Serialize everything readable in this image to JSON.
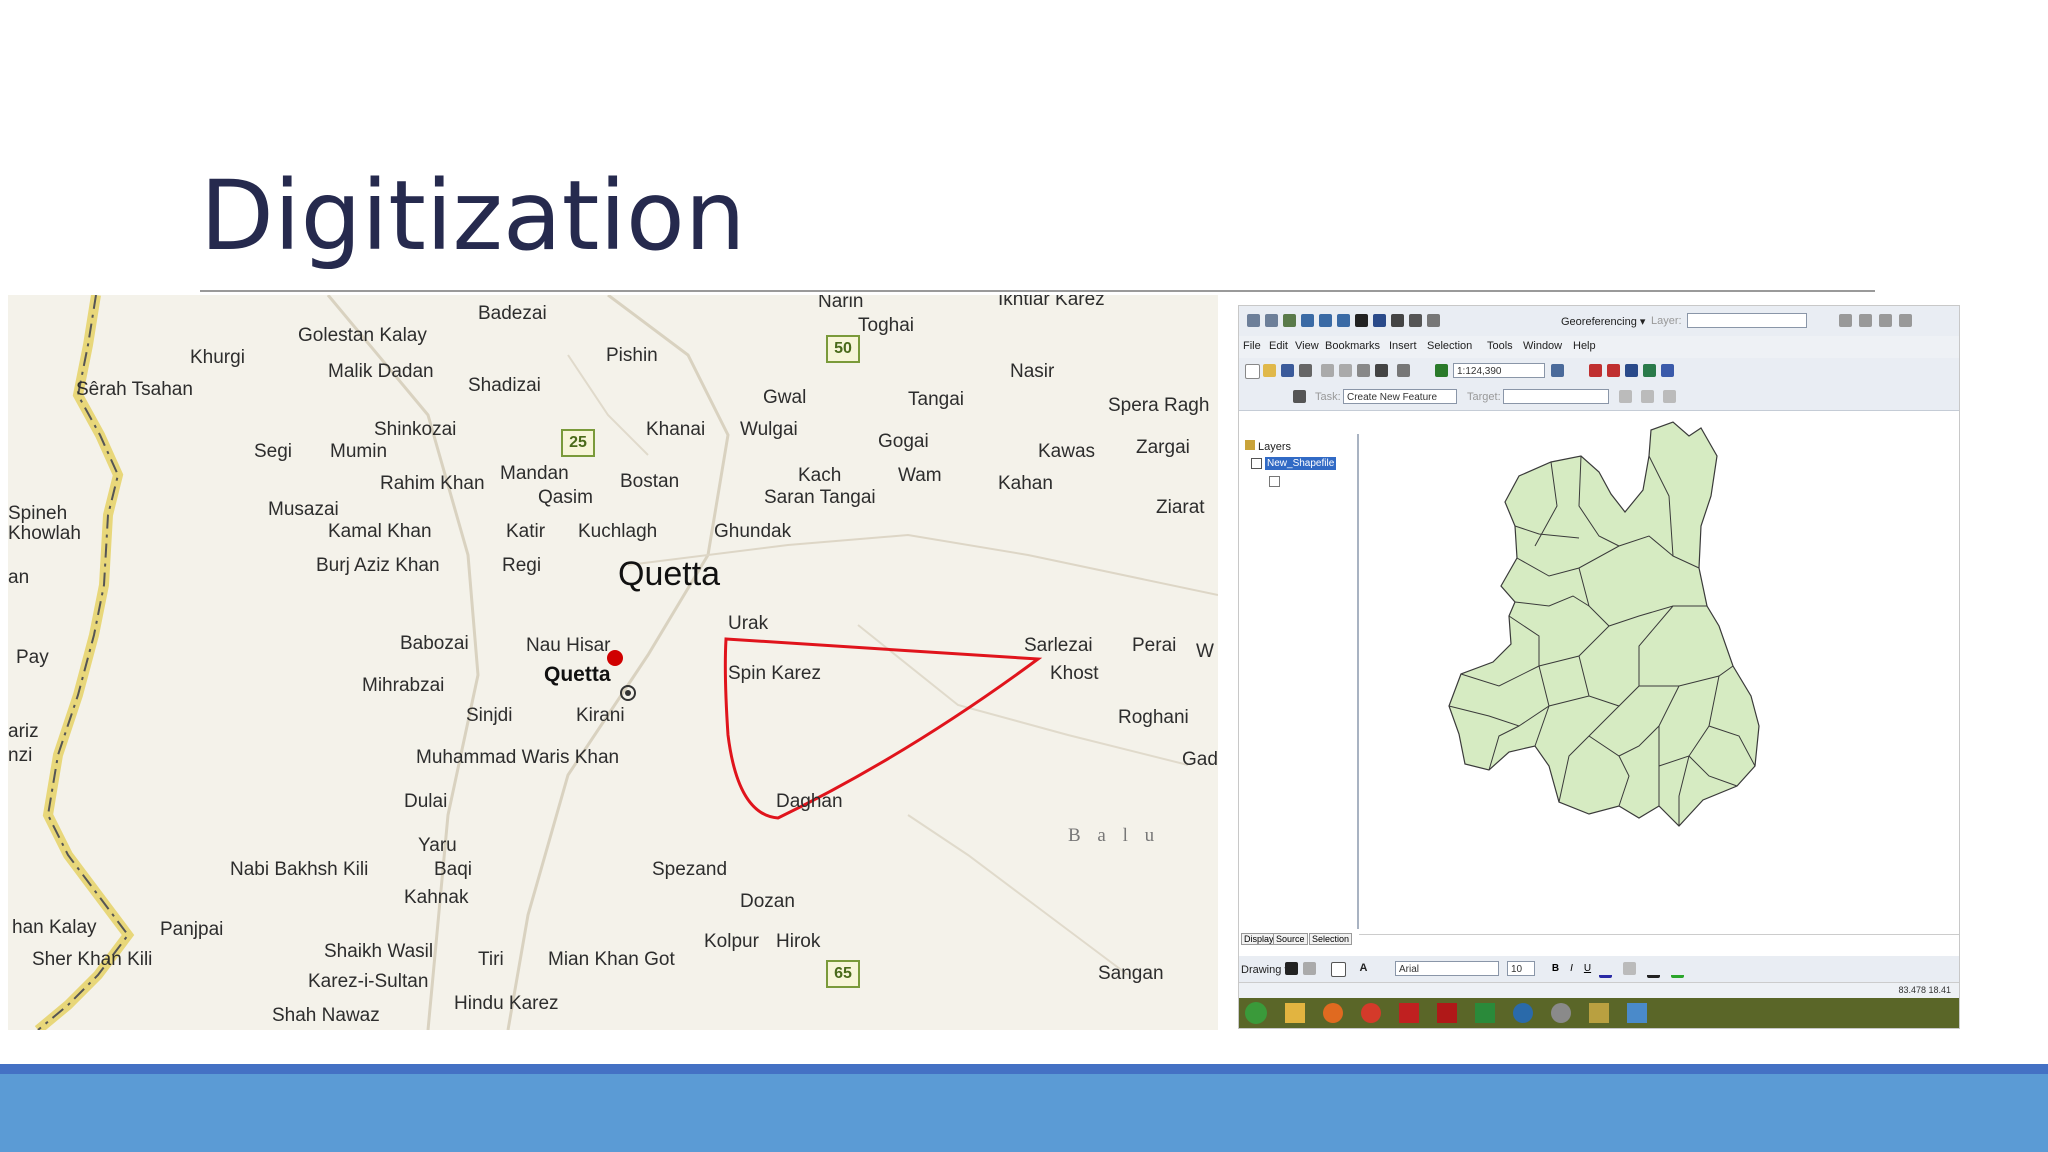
{
  "slide": {
    "title": "Digitization"
  },
  "map": {
    "cities": [
      "Quetta"
    ],
    "places": [
      "Badezai",
      "Narin",
      "Ikhtiar Karez",
      "Golestan Kalay",
      "Toghai",
      "Khurgi",
      "Pishin",
      "Malik Dadan",
      "Sêrah Tsahan",
      "Shadizai",
      "Gwal",
      "Tangai",
      "Nasir",
      "Spera Ragh",
      "Shinkozai",
      "Khanai",
      "Wulgai",
      "Gogai",
      "Kawas",
      "Zargai",
      "Segi",
      "Mumin",
      "Mandan",
      "Bostan",
      "Kach",
      "Wam",
      "Kahan",
      "Rahim Khan",
      "Qasim",
      "Saran Tangai",
      "Ziarat",
      "Spineh",
      "Khowlah",
      "Musazai",
      "Kamal Khan",
      "Katir",
      "Kuchlagh",
      "Ghundak",
      "an",
      "Burj Aziz Khan",
      "Regi",
      "Urak",
      "Babozai",
      "Nau Hisar",
      "Sarlezai",
      "Perai",
      "W",
      "Pay",
      "Spin Karez",
      "Khost",
      "Mihrabzai",
      "Sinjdi",
      "Kirani",
      "Roghani",
      "ariz",
      "nzi",
      "Muhammad Waris Khan",
      "Gad",
      "Dulai",
      "Daghan",
      "B a l u",
      "Yaru",
      "Baqi",
      "Nabi Bakhsh Kili",
      "Spezand",
      "Kahnak",
      "Dozan",
      "han Kalay",
      "Panjpai",
      "Kolpur",
      "Hirok",
      "Shaikh Wasil",
      "Tiri",
      "Mian Khan Got",
      "Sher Khan Kili",
      "Sangan",
      "Karez-i-Sultan",
      "Hindu Karez",
      "Shah Nawaz"
    ],
    "bold_places": [
      "Quetta"
    ],
    "road_shields": [
      "50",
      "25",
      "65"
    ],
    "colors": {
      "background": "#f4f2ea",
      "digitized_line": "#e0141c",
      "border": "#e8d77a",
      "road": "#d9d2c0"
    }
  },
  "gis": {
    "menu": [
      "File",
      "Edit",
      "View",
      "Bookmarks",
      "Insert",
      "Selection",
      "Tools",
      "Window",
      "Help"
    ],
    "georeferencing_label": "Georeferencing ▾",
    "layer_label": "Layer:",
    "scale_value": "1:124,390",
    "task_label": "Task:",
    "task_value": "Create New Feature",
    "target_label": "Target:",
    "toc_title": "Layers",
    "toc_layer": "New_Shapefile",
    "tabs": [
      "Display",
      "Source",
      "Selection"
    ],
    "drawing_label": "Drawing ▾",
    "font_value": "Arial",
    "font_size": "10",
    "status_coords": "83.478  18.41",
    "colors": {
      "polygon_fill": "#d6ebc2",
      "polygon_stroke": "#3a3a3a",
      "taskbar": "#5a6628",
      "highlight": "#316ac5"
    }
  },
  "footer": {
    "colors": {
      "band": "#5b9bd5",
      "line": "#4471c4"
    }
  }
}
